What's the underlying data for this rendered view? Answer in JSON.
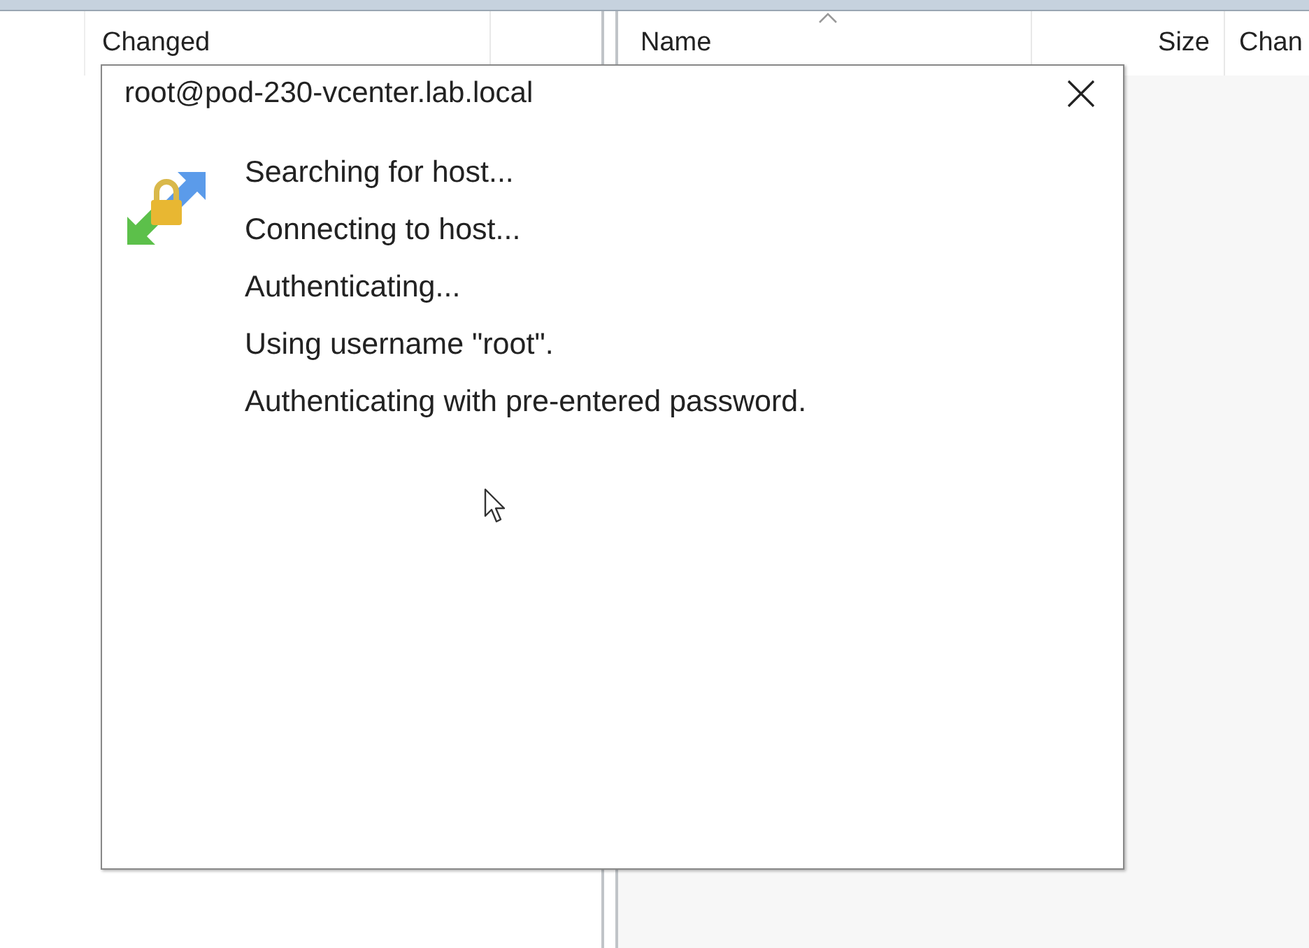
{
  "left_panel": {
    "columns": [
      {
        "label": "Changed",
        "sorted": false
      }
    ]
  },
  "right_panel": {
    "columns": [
      {
        "label": "Name",
        "sorted": true
      },
      {
        "label": "Size",
        "sorted": false
      },
      {
        "label": "Chan",
        "sorted": false
      }
    ]
  },
  "dialog": {
    "title": "root@pod-230-vcenter.lab.local",
    "messages": [
      "Searching for host...",
      "Connecting to host...",
      "Authenticating...",
      "Using username \"root\".",
      "Authenticating with pre-entered password."
    ]
  }
}
